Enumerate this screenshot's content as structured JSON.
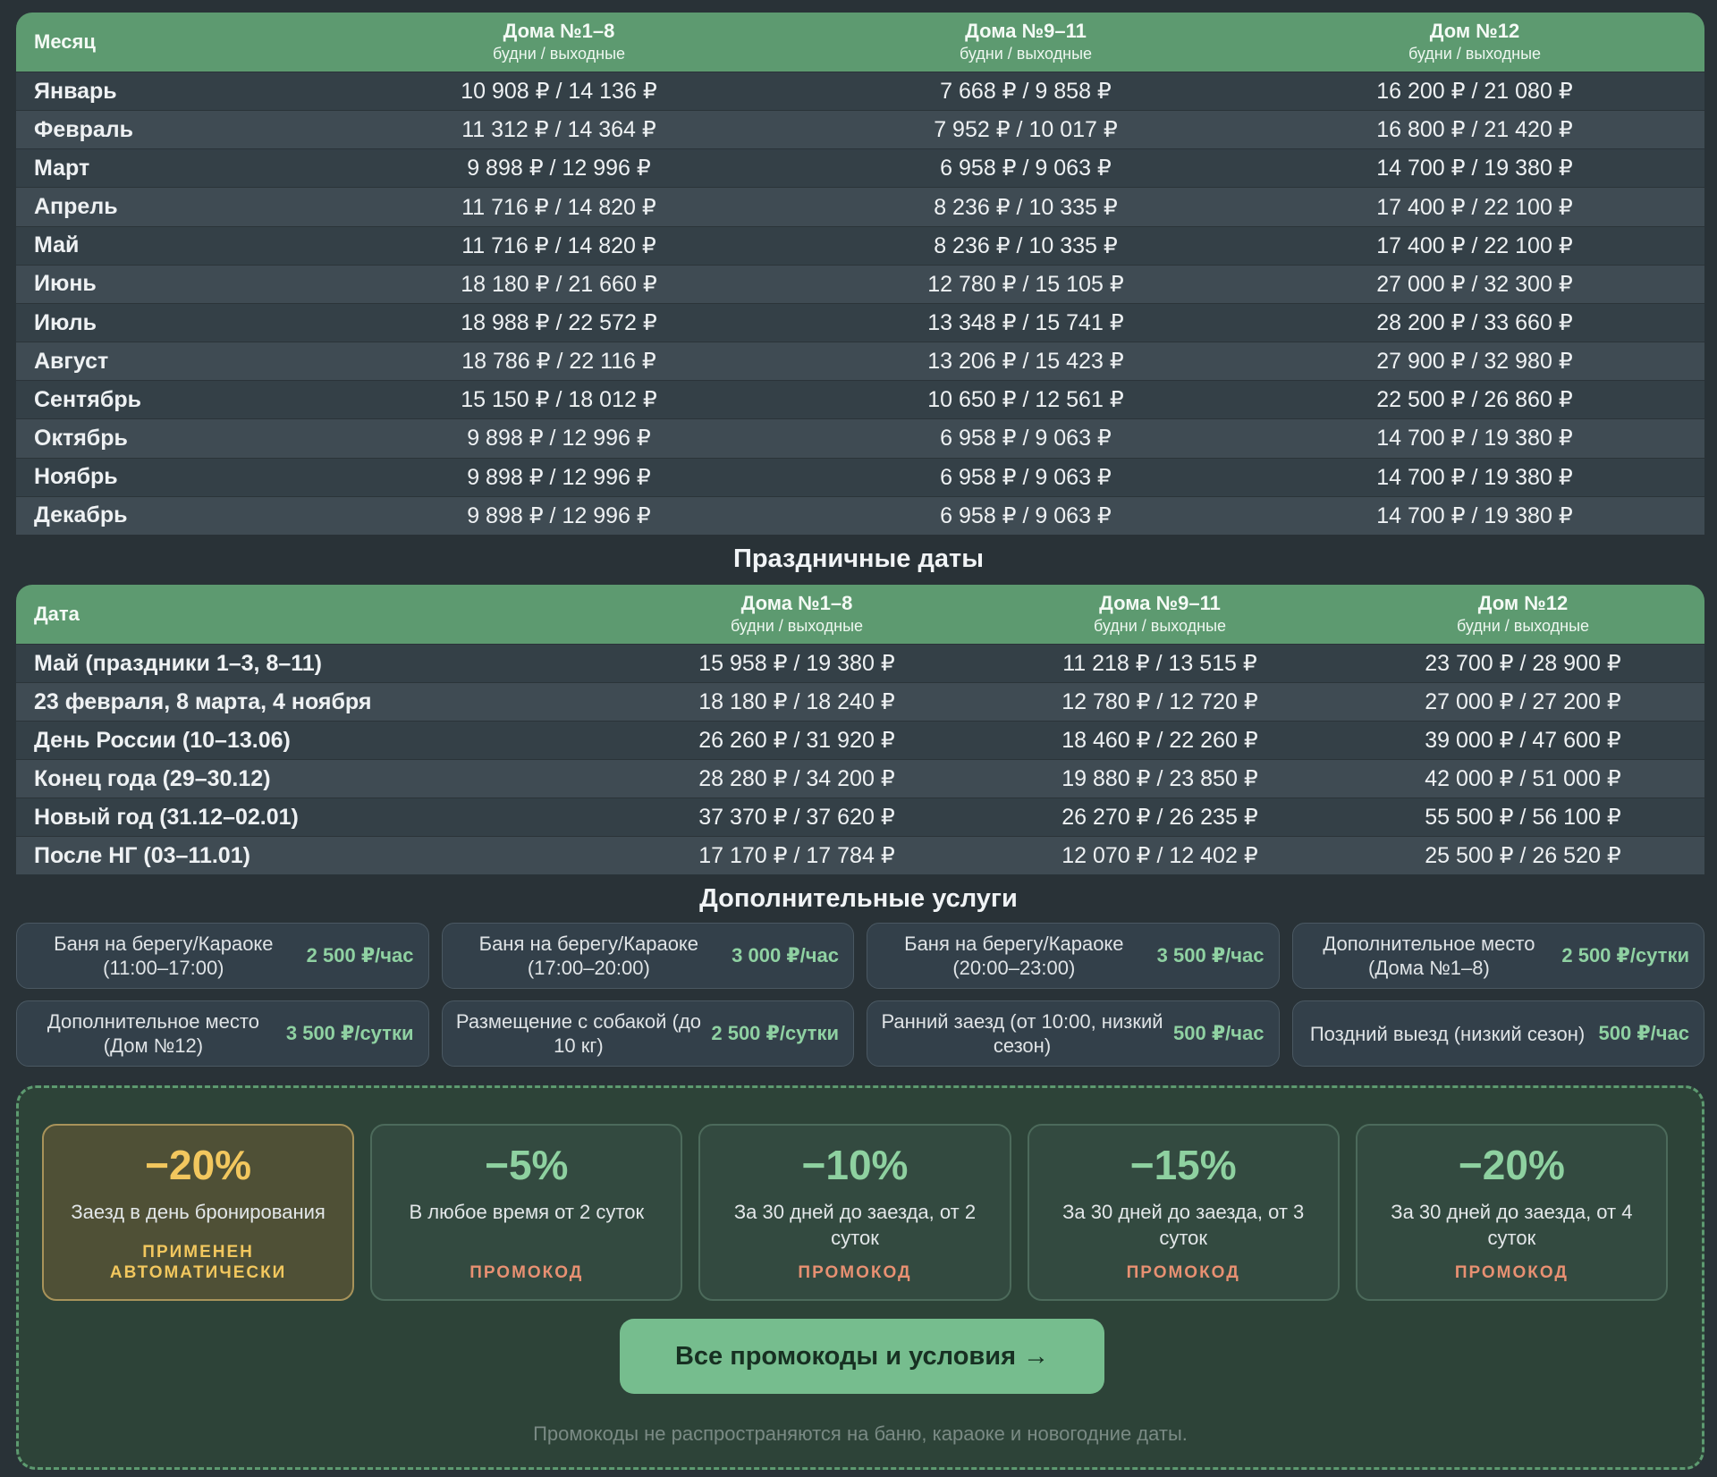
{
  "main_table": {
    "headers": [
      {
        "title": "Месяц",
        "sub": ""
      },
      {
        "title": "Дома №1–8",
        "sub": "будни / выходные"
      },
      {
        "title": "Дома №9–11",
        "sub": "будни / выходные"
      },
      {
        "title": "Дом №12",
        "sub": "будни / выходные"
      }
    ],
    "rows": [
      [
        "Январь",
        "10 908 ₽ / 14 136 ₽",
        "7 668 ₽ / 9 858 ₽",
        "16 200 ₽ / 21 080 ₽"
      ],
      [
        "Февраль",
        "11 312 ₽ / 14 364 ₽",
        "7 952 ₽ / 10 017 ₽",
        "16 800 ₽ / 21 420 ₽"
      ],
      [
        "Март",
        "9 898 ₽ / 12 996 ₽",
        "6 958 ₽ / 9 063 ₽",
        "14 700 ₽ / 19 380 ₽"
      ],
      [
        "Апрель",
        "11 716 ₽ / 14 820 ₽",
        "8 236 ₽ / 10 335 ₽",
        "17 400 ₽ / 22 100 ₽"
      ],
      [
        "Май",
        "11 716 ₽ / 14 820 ₽",
        "8 236 ₽ / 10 335 ₽",
        "17 400 ₽ / 22 100 ₽"
      ],
      [
        "Июнь",
        "18 180 ₽ / 21 660 ₽",
        "12 780 ₽ / 15 105 ₽",
        "27 000 ₽ / 32 300 ₽"
      ],
      [
        "Июль",
        "18 988 ₽ / 22 572 ₽",
        "13 348 ₽ / 15 741 ₽",
        "28 200 ₽ / 33 660 ₽"
      ],
      [
        "Август",
        "18 786 ₽ / 22 116 ₽",
        "13 206 ₽ / 15 423 ₽",
        "27 900 ₽ / 32 980 ₽"
      ],
      [
        "Сентябрь",
        "15 150 ₽ / 18 012 ₽",
        "10 650 ₽ / 12 561 ₽",
        "22 500 ₽ / 26 860 ₽"
      ],
      [
        "Октябрь",
        "9 898 ₽ / 12 996 ₽",
        "6 958 ₽ / 9 063 ₽",
        "14 700 ₽ / 19 380 ₽"
      ],
      [
        "Ноябрь",
        "9 898 ₽ / 12 996 ₽",
        "6 958 ₽ / 9 063 ₽",
        "14 700 ₽ / 19 380 ₽"
      ],
      [
        "Декабрь",
        "9 898 ₽ / 12 996 ₽",
        "6 958 ₽ / 9 063 ₽",
        "14 700 ₽ / 19 380 ₽"
      ]
    ]
  },
  "holiday_section": {
    "title": "Праздничные даты",
    "headers": [
      {
        "title": "Дата",
        "sub": ""
      },
      {
        "title": "Дома №1–8",
        "sub": "будни / выходные"
      },
      {
        "title": "Дома №9–11",
        "sub": "будни / выходные"
      },
      {
        "title": "Дом №12",
        "sub": "будни / выходные"
      }
    ],
    "rows": [
      [
        "Май (праздники 1–3, 8–11)",
        "15 958 ₽ / 19 380 ₽",
        "11 218 ₽ / 13 515 ₽",
        "23 700 ₽ / 28 900 ₽"
      ],
      [
        "23 февраля, 8 марта, 4 ноября",
        "18 180 ₽ / 18 240 ₽",
        "12 780 ₽ / 12 720 ₽",
        "27 000 ₽ / 27 200 ₽"
      ],
      [
        "День России (10–13.06)",
        "26 260 ₽ / 31 920 ₽",
        "18 460 ₽ / 22 260 ₽",
        "39 000 ₽ / 47 600 ₽"
      ],
      [
        "Конец года (29–30.12)",
        "28 280 ₽ / 34 200 ₽",
        "19 880 ₽ / 23 850 ₽",
        "42 000 ₽ / 51 000 ₽"
      ],
      [
        "Новый год (31.12–02.01)",
        "37 370 ₽ / 37 620 ₽",
        "26 270 ₽ / 26 235 ₽",
        "55 500 ₽ / 56 100 ₽"
      ],
      [
        "После НГ (03–11.01)",
        "17 170 ₽ / 17 784 ₽",
        "12 070 ₽ / 12 402 ₽",
        "25 500 ₽ / 26 520 ₽"
      ]
    ]
  },
  "services_section": {
    "title": "Дополнительные услуги",
    "items": [
      {
        "name": "Баня на берегу/Караоке (11:00–17:00)",
        "price": "2 500 ₽/час"
      },
      {
        "name": "Баня на берегу/Караоке (17:00–20:00)",
        "price": "3 000 ₽/час"
      },
      {
        "name": "Баня на берегу/Караоке (20:00–23:00)",
        "price": "3 500 ₽/час"
      },
      {
        "name": "Дополнительное место (Дома №1–8)",
        "price": "2 500 ₽/сутки"
      },
      {
        "name": "Дополнительное место (Дом №12)",
        "price": "3 500 ₽/сутки"
      },
      {
        "name": "Размещение с собакой (до 10 кг)",
        "price": "2 500 ₽/сутки"
      },
      {
        "name": "Ранний заезд (от 10:00, низкий сезон)",
        "price": "500 ₽/час"
      },
      {
        "name": "Поздний выезд (низкий сезон)",
        "price": "500 ₽/час"
      }
    ]
  },
  "promo": {
    "deals": [
      {
        "percent": "−20%",
        "desc": "Заезд в день бронирования",
        "tag": "ПРИМЕНЕН АВТОМАТИЧЕСКИ",
        "auto": true
      },
      {
        "percent": "−5%",
        "desc": "В любое время от 2 суток",
        "tag": "ПРОМОКОД",
        "auto": false
      },
      {
        "percent": "−10%",
        "desc": "За 30 дней до заезда, от 2 суток",
        "tag": "ПРОМОКОД",
        "auto": false
      },
      {
        "percent": "−15%",
        "desc": "За 30 дней до заезда, от 3 суток",
        "tag": "ПРОМОКОД",
        "auto": false
      },
      {
        "percent": "−20%",
        "desc": "За 30 дней до заезда, от 4 суток",
        "tag": "ПРОМОКОД",
        "auto": false
      }
    ],
    "button_label": "Все промокоды и условия →",
    "note": "Промокоды не распространяются на баню, караоке и новогодние даты."
  },
  "colors": {
    "background": "#293237",
    "header_green": "#5d9a70",
    "price_green": "#8fd1a2",
    "auto_gold": "#f2c75e",
    "promo_tag": "#e89072",
    "button_green": "#76bd8e"
  }
}
